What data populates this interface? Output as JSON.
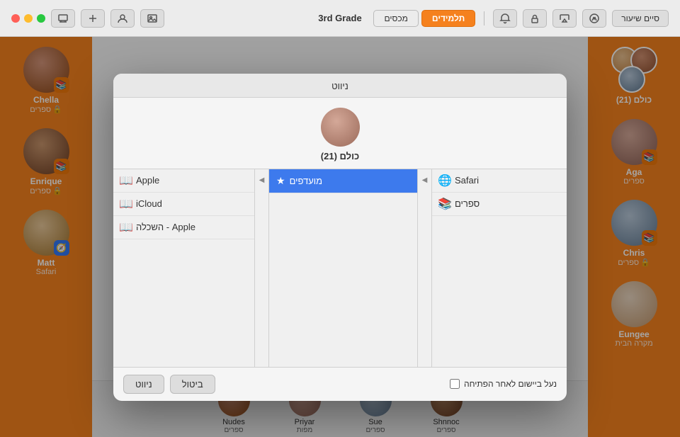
{
  "window": {
    "title": "3rd Grade"
  },
  "toolbar": {
    "tab_devices": "מכסים",
    "tab_students": "תלמידים",
    "end_session": "סיים שיעור"
  },
  "left_sidebar": {
    "students": [
      {
        "name": "Chella",
        "app": "ספרים",
        "app_type": "books",
        "avatar_class": "av-chella"
      },
      {
        "name": "Enrique",
        "app": "ספרים",
        "app_type": "books",
        "avatar_class": "av-enrique"
      },
      {
        "name": "Matt",
        "app": "Safari",
        "app_type": "safari",
        "avatar_class": "av-matt"
      }
    ]
  },
  "right_sidebar": {
    "group_name": "כולם (21)",
    "students": [
      {
        "name": "Aga",
        "app": "ספרים",
        "app_type": "books",
        "avatar_class": "av-aga"
      },
      {
        "name": "Chris",
        "app": "ספרים",
        "app_type": "books",
        "avatar_class": "av-chris"
      },
      {
        "name": "Eungee",
        "app": "מקרה הבית",
        "app_type": "home",
        "avatar_class": "av-eungee"
      }
    ]
  },
  "dialog": {
    "title": "ניווט",
    "student_name": "כולם (21)",
    "left_panel": {
      "items": [
        {
          "label": "Apple",
          "icon": "book"
        },
        {
          "label": "iCloud",
          "icon": "book"
        },
        {
          "label": "Apple - השכלה",
          "icon": "book"
        }
      ]
    },
    "middle_panel": {
      "selected_item": "מועדפים",
      "star_icon": "★"
    },
    "right_panel": {
      "items": [
        {
          "label": "Safari",
          "icon": "globe"
        },
        {
          "label": "ספרים",
          "icon": "book"
        }
      ]
    },
    "footer": {
      "checkbox_label": "נעל ביישום לאחר הפתיחה",
      "cancel_btn": "ביטול",
      "navigate_btn": "ניווט"
    }
  },
  "bottom_bar": {
    "students": [
      {
        "name": "Nudes",
        "app": "ספרים",
        "avatar_class": "av-chella"
      },
      {
        "name": "Priyar",
        "app": "מפות",
        "avatar_class": "av-aga"
      },
      {
        "name": "Sue",
        "app": "ספרים",
        "avatar_class": "av-chris"
      },
      {
        "name": "Shnnoc",
        "app": "ספרים",
        "avatar_class": "av-enrique"
      }
    ]
  },
  "icons": {
    "book": "📚",
    "globe": "🌐",
    "star": "★",
    "lock": "🔒",
    "arrow_left": "◀",
    "compass": "🧭"
  },
  "colors": {
    "orange": "#f5811e",
    "blue_selected": "#3d7aed",
    "title_bar_bg": "#ececec"
  }
}
